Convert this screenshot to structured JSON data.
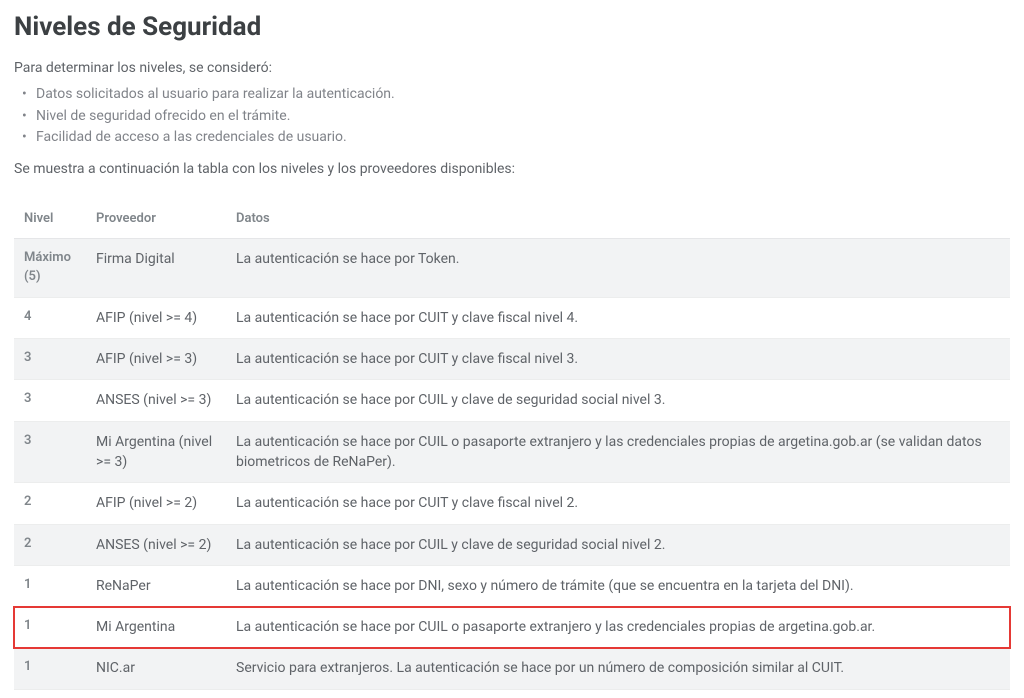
{
  "title": "Niveles de Seguridad",
  "intro": "Para determinar los niveles, se consideró:",
  "criteria": [
    "Datos solicitados al usuario para realizar la autenticación.",
    "Nivel de seguridad ofrecido en el trámite.",
    "Facilidad de acceso a las credenciales de usuario."
  ],
  "subtext": "Se muestra a continuación la tabla con los niveles y los proveedores disponibles:",
  "table": {
    "headers": {
      "nivel": "Nivel",
      "proveedor": "Proveedor",
      "datos": "Datos"
    },
    "rows": [
      {
        "nivel": "Máximo",
        "nivel_sub": "(5)",
        "proveedor": "Firma Digital",
        "datos": "La autenticación se hace por Token.",
        "shaded": true
      },
      {
        "nivel": "4",
        "proveedor": "AFIP (nivel >= 4)",
        "datos": "La autenticación se hace por CUIT y clave fiscal nivel 4.",
        "shaded": false
      },
      {
        "nivel": "3",
        "proveedor": "AFIP (nivel >= 3)",
        "datos": "La autenticación se hace por CUIT y clave fiscal nivel 3.",
        "shaded": true
      },
      {
        "nivel": "3",
        "proveedor": "ANSES (nivel >= 3)",
        "datos": "La autenticación se hace por CUIL y clave de seguridad social nivel 3.",
        "shaded": false
      },
      {
        "nivel": "3",
        "proveedor": "Mi Argentina (nivel >= 3)",
        "datos": "La autenticación se hace por CUIL o pasaporte extranjero y las credenciales propias de argetina.gob.ar (se validan datos biometricos de ReNaPer).",
        "shaded": true
      },
      {
        "nivel": "2",
        "proveedor": "AFIP (nivel >= 2)",
        "datos": "La autenticación se hace por CUIT y clave fiscal nivel 2.",
        "shaded": false
      },
      {
        "nivel": "2",
        "proveedor": "ANSES (nivel >= 2)",
        "datos": "La autenticación se hace por CUIL y clave de seguridad social nivel 2.",
        "shaded": true
      },
      {
        "nivel": "1",
        "proveedor": "ReNaPer",
        "datos": "La autenticación se hace por DNI, sexo y número de trámite (que se encuentra en la tarjeta del DNI).",
        "shaded": false
      },
      {
        "nivel": "1",
        "proveedor": "Mi Argentina",
        "datos": "La autenticación se hace por CUIL o pasaporte extranjero y las credenciales propias de argetina.gob.ar.",
        "shaded": false,
        "highlight": true
      },
      {
        "nivel": "1",
        "proveedor": "NIC.ar",
        "datos": "Servicio para extranjeros. La autenticación se hace por un número de composición similar al CUIT.",
        "shaded": true
      }
    ]
  }
}
